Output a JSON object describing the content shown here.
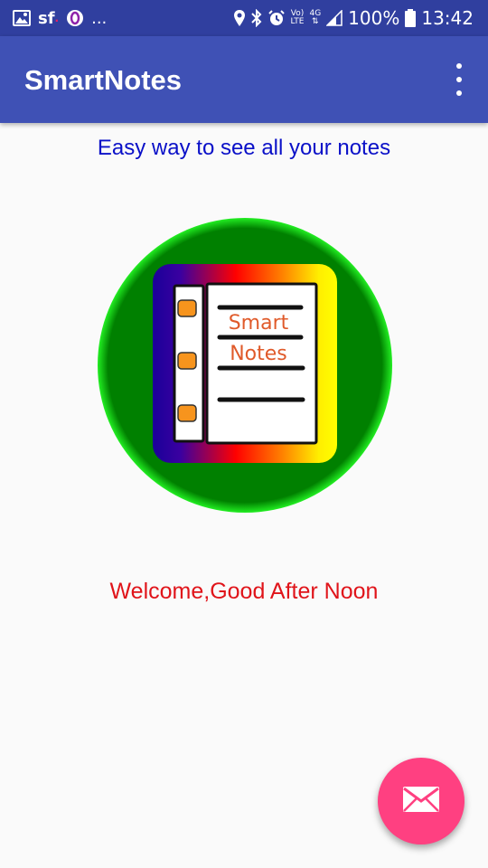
{
  "status_bar": {
    "sf_label": "sf",
    "ellipsis": "...",
    "volte_top": "Vo)",
    "volte_bottom": "LTE",
    "network": "4G",
    "battery": "100%",
    "time": "13:42"
  },
  "app_bar": {
    "title": "SmartNotes",
    "menu_icon": "more-vert-icon"
  },
  "main": {
    "subtitle": "Easy way to see all your notes",
    "logo_text_line1": "Smart",
    "logo_text_line2": "Notes",
    "welcome": "Welcome,Good After Noon"
  },
  "fab": {
    "icon": "mail-icon"
  },
  "colors": {
    "status_bar": "#303f9f",
    "primary": "#3f51b5",
    "accent": "#ff4081",
    "subtitle": "#0a10c8",
    "welcome": "#e0141a",
    "logo_circle": "#008000"
  }
}
